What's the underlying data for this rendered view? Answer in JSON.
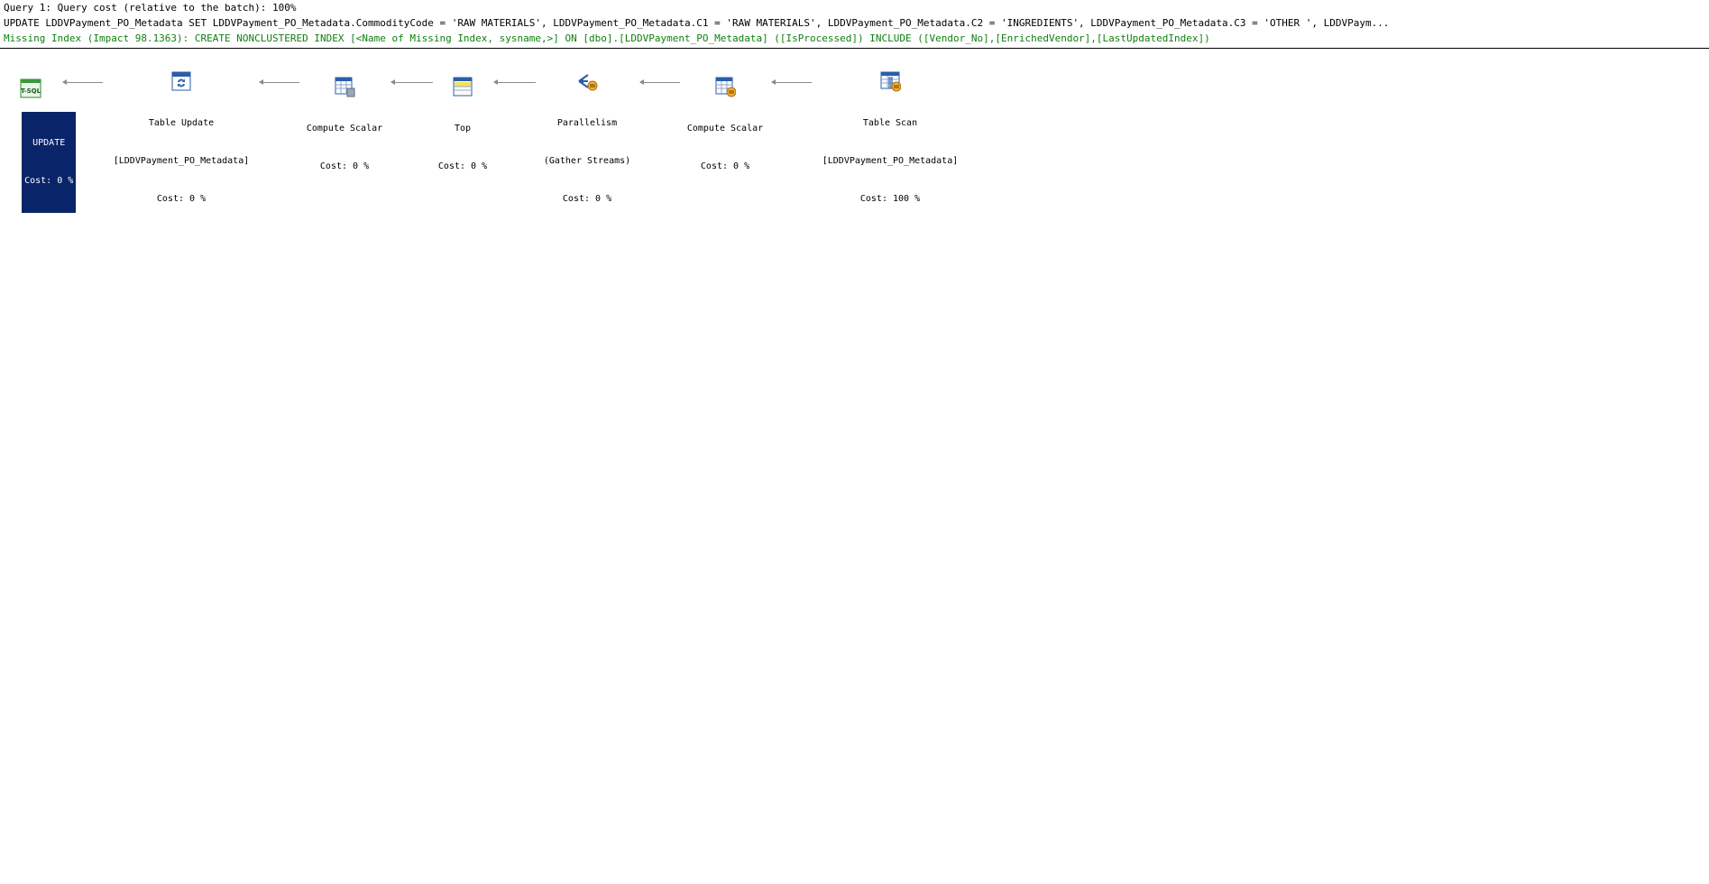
{
  "header": {
    "query_line": "Query 1: Query cost (relative to the batch): 100%",
    "statement": "UPDATE LDDVPayment_PO_Metadata SET LDDVPayment_PO_Metadata.CommodityCode = 'RAW MATERIALS', LDDVPayment_PO_Metadata.C1 = 'RAW MATERIALS', LDDVPayment_PO_Metadata.C2 = 'INGREDIENTS', LDDVPayment_PO_Metadata.C3 = 'OTHER ', LDDVPaym...",
    "missing_index": "Missing Index (Impact 98.1363): CREATE NONCLUSTERED INDEX [<Name of Missing Index, sysname,>] ON [dbo].[LDDVPayment_PO_Metadata] ([IsProcessed]) INCLUDE ([Vendor_No],[EnrichedVendor],[LastUpdatedIndex])",
    "missing_index_color": "#108010"
  },
  "plan": {
    "selection_color": "#0a246a",
    "nodes": [
      {
        "id": "update",
        "icon": "tsql-icon",
        "name": "UPDATE",
        "object": "",
        "cost": "Cost: 0 %",
        "selected": true
      },
      {
        "id": "table-update",
        "icon": "table-update-icon",
        "name": "Table Update",
        "object": "[LDDVPayment_PO_Metadata]",
        "cost": "Cost: 0 %",
        "selected": false
      },
      {
        "id": "compute-scalar-1",
        "icon": "compute-scalar-icon",
        "name": "Compute Scalar",
        "object": "",
        "cost": "Cost: 0 %",
        "selected": false
      },
      {
        "id": "top",
        "icon": "top-icon",
        "name": "Top",
        "object": "",
        "cost": "Cost: 0 %",
        "selected": false
      },
      {
        "id": "parallelism",
        "icon": "parallelism-icon",
        "name": "Parallelism",
        "object": "(Gather Streams)",
        "cost": "Cost: 0 %",
        "selected": false
      },
      {
        "id": "compute-scalar-2",
        "icon": "compute-scalar-icon",
        "name": "Compute Scalar",
        "object": "",
        "cost": "Cost: 0 %",
        "selected": false
      },
      {
        "id": "table-scan",
        "icon": "table-scan-icon",
        "name": "Table Scan",
        "object": "[LDDVPayment_PO_Metadata]",
        "cost": "Cost: 100 %",
        "selected": false
      }
    ]
  }
}
